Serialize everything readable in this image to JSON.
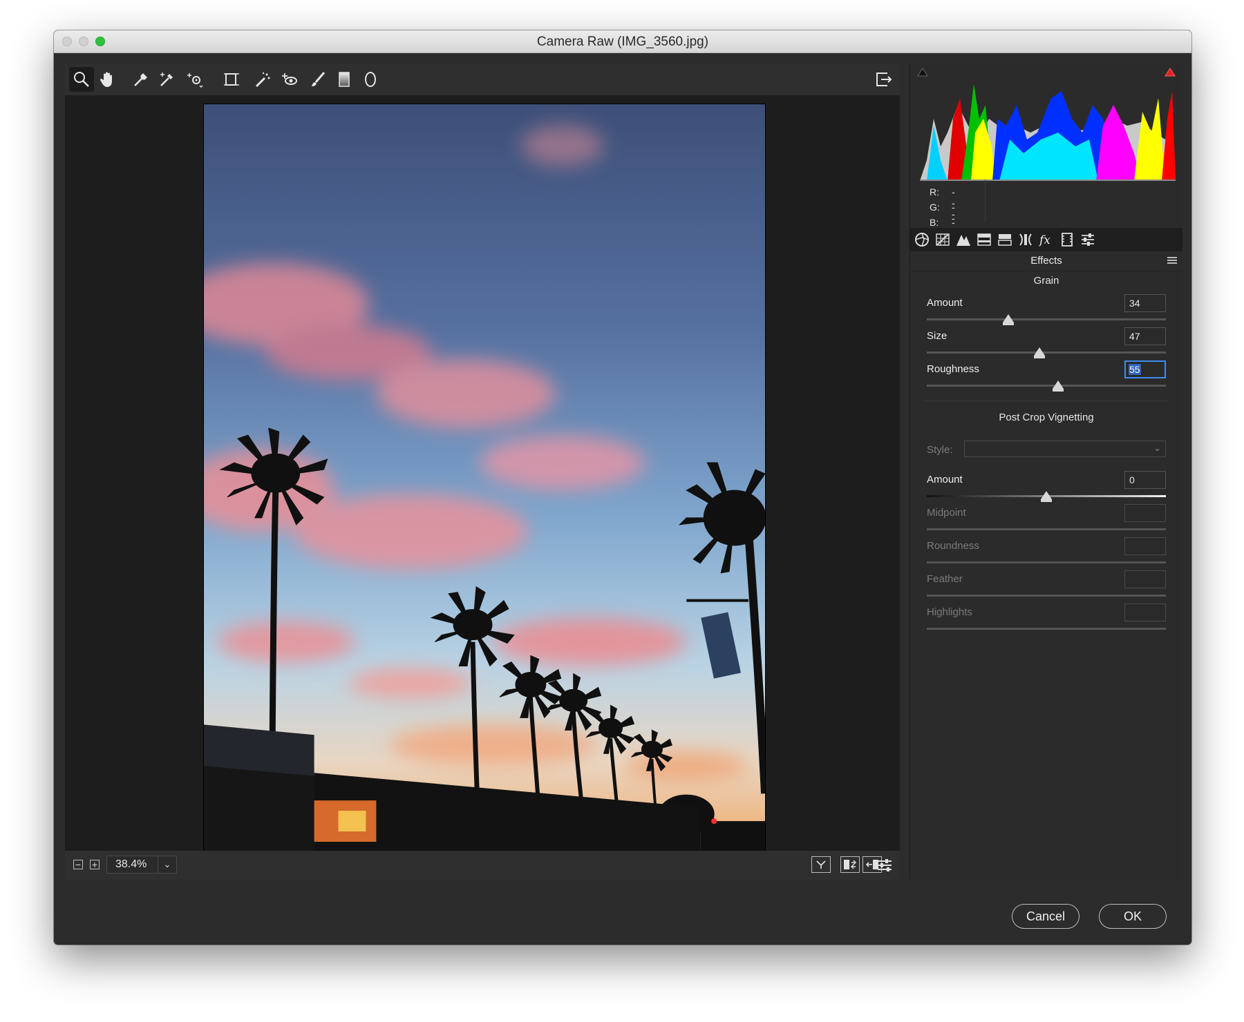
{
  "window": {
    "title": "Camera Raw (IMG_3560.jpg)"
  },
  "toolbar": {
    "tools": [
      "zoom-icon",
      "hand-icon",
      "white-balance-icon",
      "color-sampler-icon",
      "targeted-adjustment-icon",
      "transform-icon",
      "spot-removal-icon",
      "red-eye-icon",
      "adjustment-brush-icon",
      "graduated-filter-icon",
      "radial-filter-icon"
    ],
    "open_preferences": "export-icon"
  },
  "histogram": {
    "readout": {
      "r_label": "R:",
      "r_value": "---",
      "g_label": "G:",
      "g_value": "---",
      "b_label": "B:",
      "b_value": "---"
    }
  },
  "panel": {
    "title": "Effects",
    "grain": {
      "title": "Grain",
      "amount": {
        "label": "Amount",
        "value": "34",
        "level": 34
      },
      "size": {
        "label": "Size",
        "value": "47",
        "level": 47
      },
      "roughness": {
        "label": "Roughness",
        "value": "55",
        "level": 55
      }
    },
    "vignette": {
      "title": "Post Crop Vignetting",
      "style_label": "Style:",
      "amount": {
        "label": "Amount",
        "value": "0",
        "level": 0
      },
      "midpoint": {
        "label": "Midpoint"
      },
      "roundness": {
        "label": "Roundness"
      },
      "feather": {
        "label": "Feather"
      },
      "highlights": {
        "label": "Highlights"
      }
    }
  },
  "bottombar": {
    "zoom": "38.4%"
  },
  "footer": {
    "cancel": "Cancel",
    "ok": "OK"
  },
  "colors": {
    "window_bg": "#2c2c2c",
    "canvas_bg": "#1d1d1d",
    "accent_focus": "#3d8ef0",
    "zoom_button": "#2fc23f"
  }
}
